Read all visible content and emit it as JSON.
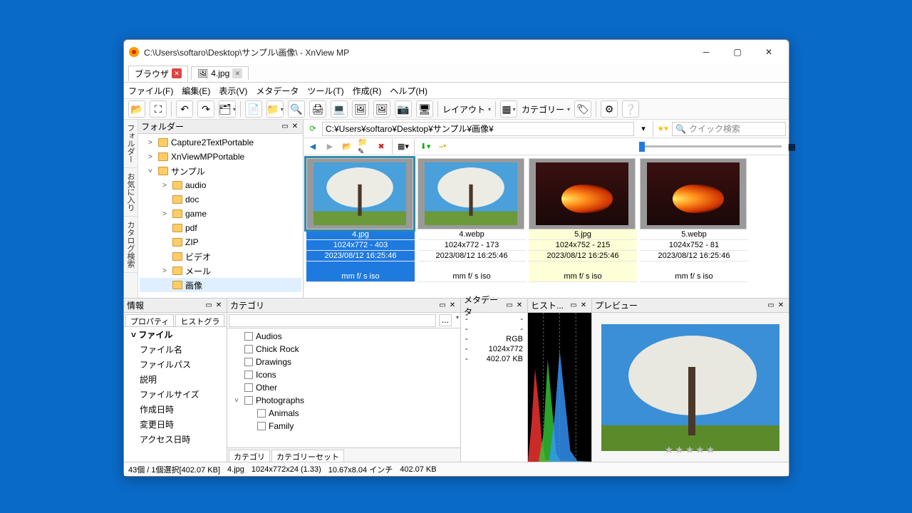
{
  "window": {
    "title": "C:\\Users\\softaro\\Desktop\\サンプル\\画像\\ - XnView MP"
  },
  "tabs": {
    "browser": "ブラウザ",
    "file": "4.jpg"
  },
  "menubar": [
    "ファイル(F)",
    "編集(E)",
    "表示(V)",
    "メタデータ",
    "ツール(T)",
    "作成(R)",
    "ヘルプ(H)"
  ],
  "toolbar": {
    "layout": "レイアウト",
    "category": "カテゴリー"
  },
  "panels": {
    "folder": "フォルダー",
    "info": "情報",
    "category": "カテゴリ",
    "metadata": "メタデータ",
    "histogram": "ヒスト...",
    "preview": "プレビュー"
  },
  "vtabs": [
    "フォルダー",
    "お気に入り",
    "カタログ検索"
  ],
  "tree": [
    {
      "indent": 0,
      "exp": ">",
      "label": "Capture2TextPortable"
    },
    {
      "indent": 0,
      "exp": ">",
      "label": "XnViewMPPortable"
    },
    {
      "indent": 0,
      "exp": "˅",
      "label": "サンプル"
    },
    {
      "indent": 1,
      "exp": ">",
      "label": "audio"
    },
    {
      "indent": 1,
      "exp": "",
      "label": "doc"
    },
    {
      "indent": 1,
      "exp": ">",
      "label": "game"
    },
    {
      "indent": 1,
      "exp": "",
      "label": "pdf"
    },
    {
      "indent": 1,
      "exp": "",
      "label": "ZIP"
    },
    {
      "indent": 1,
      "exp": "",
      "label": "ビデオ"
    },
    {
      "indent": 1,
      "exp": ">",
      "label": "メール"
    },
    {
      "indent": 1,
      "exp": "",
      "label": "画像",
      "sel": true
    }
  ],
  "address": {
    "path": "C:¥Users¥softaro¥Desktop¥サンプル¥画像¥",
    "search_placeholder": "クイック検索"
  },
  "thumbs": [
    {
      "name": "4.jpg",
      "dim": "1024x772 - 403",
      "date": "2023/08/12 16:25:46",
      "exif": "mm f/ s iso",
      "sel": true,
      "kind": "tree"
    },
    {
      "name": "4.webp",
      "dim": "1024x772 - 173",
      "date": "2023/08/12 16:25:46",
      "exif": "mm f/ s iso",
      "kind": "tree"
    },
    {
      "name": "5.jpg",
      "dim": "1024x752 - 215",
      "date": "2023/08/12 16:25:46",
      "exif": "mm f/ s iso",
      "hl": true,
      "kind": "fire"
    },
    {
      "name": "5.webp",
      "dim": "1024x752 - 81",
      "date": "2023/08/12 16:25:46",
      "exif": "mm f/ s iso",
      "kind": "fire"
    }
  ],
  "info": {
    "tabs": [
      "プロパティ",
      "ヒストグラ"
    ],
    "group": "ファイル",
    "rows": [
      "ファイル名",
      "ファイルパス",
      "説明",
      "ファイルサイズ",
      "作成日時",
      "変更日時",
      "アクセス日時"
    ]
  },
  "categories": {
    "items": [
      {
        "label": "Audios"
      },
      {
        "label": "Chick Rock"
      },
      {
        "label": "Drawings"
      },
      {
        "label": "Icons"
      },
      {
        "label": "Other"
      },
      {
        "label": "Photographs",
        "expandable": true
      },
      {
        "label": "Animals",
        "indent": 1
      },
      {
        "label": "Family",
        "indent": 1
      }
    ],
    "tabs": [
      "カテゴリ",
      "カテゴリーセット"
    ],
    "ellipsis": "..."
  },
  "metadata": {
    "rgb": "RGB",
    "rows": [
      {
        "k": "-",
        "v": "1024x772"
      },
      {
        "k": "-",
        "v": "402.07 KB"
      }
    ]
  },
  "status": {
    "count": "43個 / 1個選択[402.07 KB]",
    "name": "4.jpg",
    "dim": "1024x772x24 (1.33)",
    "inch": "10.67x8.04 インチ",
    "size": "402.07 KB"
  }
}
